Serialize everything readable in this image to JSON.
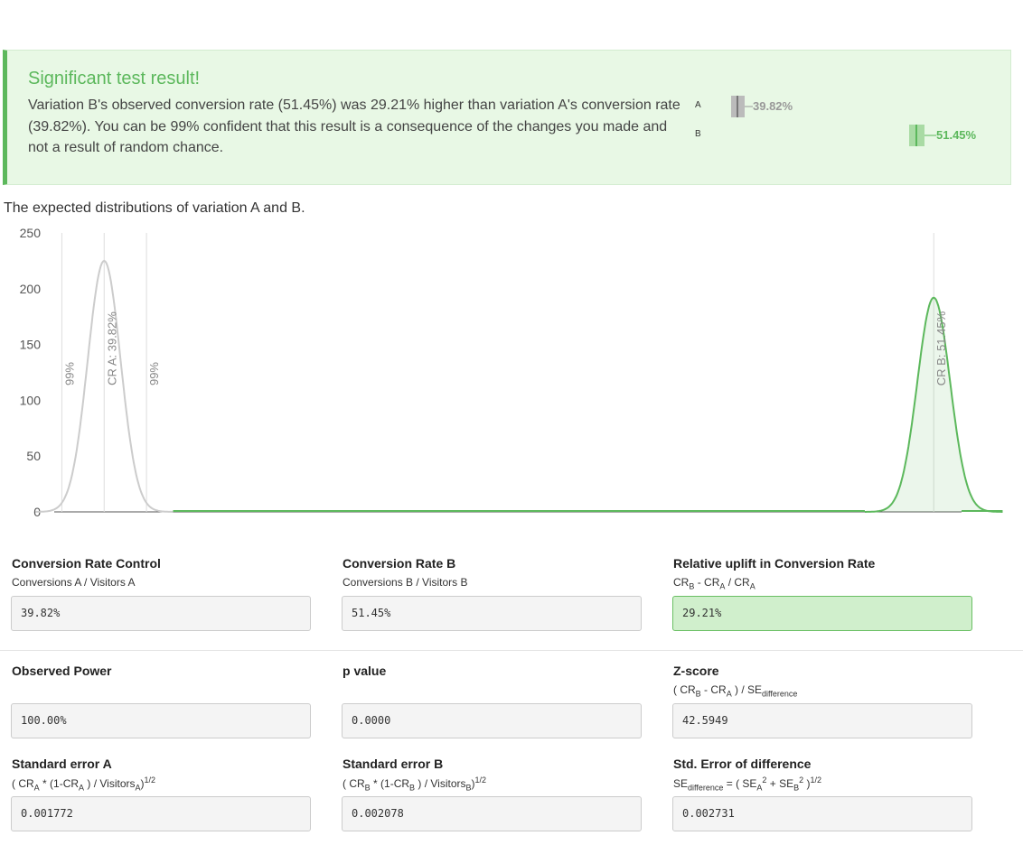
{
  "alert": {
    "title": "Significant test result!",
    "body": "Variation B's observed conversion rate (51.45%) was 29.21% higher than variation A's conversion rate (39.82%). You can be 99% confident that this result is a consequence of the changes you made and not a result of random chance.",
    "mini_chart": {
      "rows": [
        {
          "label": "A",
          "value": "39.82%",
          "color": "#999999"
        },
        {
          "label": "B",
          "value": "51.45%",
          "color": "#5cb85c"
        }
      ]
    }
  },
  "chart_caption": "The expected distributions of variation A and B.",
  "chart_data": {
    "type": "area",
    "title": "",
    "xlabel": "",
    "ylabel": "",
    "ylim": [
      0,
      250
    ],
    "yticks": [
      0,
      50,
      100,
      150,
      200,
      250
    ],
    "grid": false,
    "series": [
      {
        "name": "A",
        "mean": 0.3982,
        "peak": 225,
        "color": "#cccccc",
        "fill": false
      },
      {
        "name": "B",
        "mean": 0.5145,
        "peak": 192,
        "color": "#5cb85c",
        "fill": true
      }
    ],
    "annotations": [
      {
        "text": "99%",
        "series": "A",
        "side": "low"
      },
      {
        "text": "CR A: 39.82%",
        "series": "A",
        "side": "mean"
      },
      {
        "text": "99%",
        "series": "A",
        "side": "high"
      },
      {
        "text": "CR B: 51.45%",
        "series": "B",
        "side": "mean"
      }
    ]
  },
  "fields": {
    "cr_control": {
      "title": "Conversion Rate Control",
      "value": "39.82%"
    },
    "cr_b": {
      "title": "Conversion Rate B",
      "value": "51.45%"
    },
    "uplift": {
      "title": "Relative uplift in Conversion Rate",
      "value": "29.21%"
    },
    "power": {
      "title": "Observed Power",
      "value": "100.00%"
    },
    "pvalue": {
      "title": "p value",
      "value": "0.0000"
    },
    "zscore": {
      "title": "Z-score",
      "value": "42.5949"
    },
    "se_a": {
      "title": "Standard error A",
      "value": "0.001772"
    },
    "se_b": {
      "title": "Standard error B",
      "value": "0.002078"
    },
    "se_diff": {
      "title": "Std. Error of difference",
      "value": "0.002731"
    }
  }
}
